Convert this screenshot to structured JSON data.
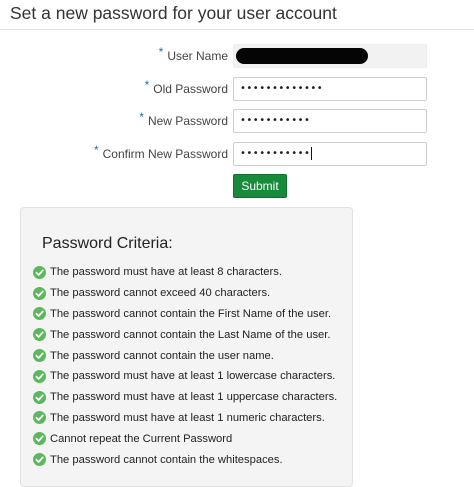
{
  "page": {
    "title": "Set a new password for your user account"
  },
  "form": {
    "required_marker": "*",
    "fields": [
      {
        "label": "User Name",
        "value": "",
        "redacted": true
      },
      {
        "label": "Old Password",
        "value": "•••••••••••••"
      },
      {
        "label": "New Password",
        "value": "•••••••••••"
      },
      {
        "label": "Confirm New Password",
        "value": "•••••••••••"
      }
    ],
    "submit_label": "Submit"
  },
  "criteria": {
    "title": "Password Criteria:",
    "icon": "check-circle-icon",
    "icon_color": "#5cb85c",
    "items": [
      "The password must have at least 8 characters.",
      "The password cannot exceed 40 characters.",
      "The password cannot contain the First Name of the user.",
      "The password cannot contain the Last Name of the user.",
      "The password cannot contain the user name.",
      "The password must have at least 1 lowercase characters.",
      "The password must have at least 1 uppercase characters.",
      "The password must have at least 1 numeric characters.",
      "Cannot repeat the Current Password",
      "The password cannot contain the whitespaces."
    ]
  },
  "colors": {
    "submit_button": "#178a3c",
    "required_star": "#1f6fb5",
    "panel_background": "#f4f4f4"
  }
}
